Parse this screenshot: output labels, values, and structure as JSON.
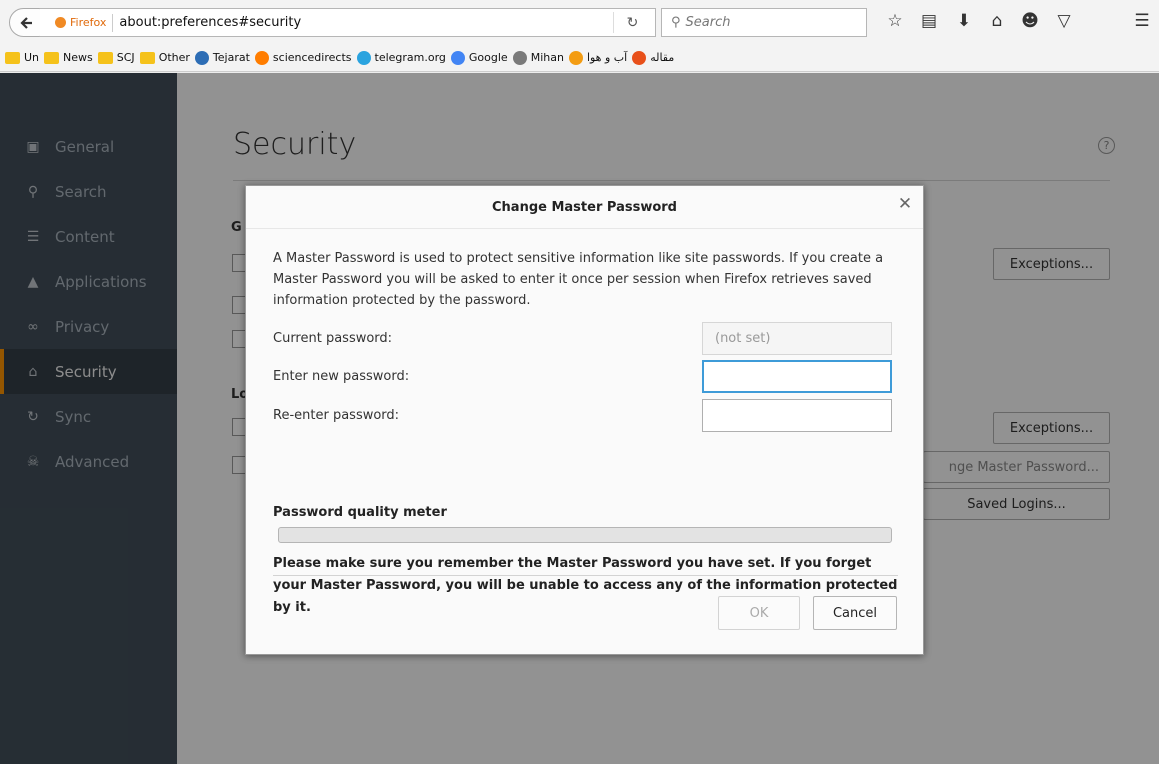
{
  "browser": {
    "identity_label": "Firefox",
    "url": "about:preferences#security",
    "reload_glyph": "↻",
    "search_placeholder": "Search",
    "toolbar_icons": [
      "star-icon",
      "reading-list-icon",
      "download-icon",
      "home-icon",
      "chat-icon",
      "pocket-icon",
      "hamburger-menu-icon"
    ]
  },
  "bookmarks": [
    {
      "label": "Un",
      "icon": "folder"
    },
    {
      "label": "News",
      "icon": "folder"
    },
    {
      "label": "SCJ",
      "icon": "folder"
    },
    {
      "label": "Other",
      "icon": "folder"
    },
    {
      "label": "Tejarat",
      "icon": "tejarat-icon",
      "color": "#2d6db5"
    },
    {
      "label": "sciencedirects",
      "icon": "elsevier-icon",
      "color": "#ff7d00"
    },
    {
      "label": "telegram.org",
      "icon": "telegram-icon",
      "color": "#2aa3df"
    },
    {
      "label": "Google",
      "icon": "google-icon",
      "color": "#4285f4"
    },
    {
      "label": "Mihan",
      "icon": "mihan-icon",
      "color": "#7a7a7a"
    },
    {
      "label": "آب و هوا",
      "icon": "weather-icon",
      "color": "#f39c12"
    },
    {
      "label": "مقاله",
      "icon": "eye-icon",
      "color": "#e8501a"
    }
  ],
  "sidebar": {
    "items": [
      {
        "label": "General",
        "icon": "general-icon",
        "glyph": "▣"
      },
      {
        "label": "Search",
        "icon": "search-icon",
        "glyph": "⚲"
      },
      {
        "label": "Content",
        "icon": "content-icon",
        "glyph": "☰"
      },
      {
        "label": "Applications",
        "icon": "applications-icon",
        "glyph": "▲"
      },
      {
        "label": "Privacy",
        "icon": "privacy-mask-icon",
        "glyph": "∞"
      },
      {
        "label": "Security",
        "icon": "security-lock-icon",
        "glyph": "⌂",
        "selected": true
      },
      {
        "label": "Sync",
        "icon": "sync-icon",
        "glyph": "↻"
      },
      {
        "label": "Advanced",
        "icon": "advanced-icon",
        "glyph": "☠"
      }
    ]
  },
  "page": {
    "title": "Security",
    "help_glyph": "?",
    "heading_fragment_1": "G",
    "heading_fragment_2": "Lo",
    "exceptions_label_1": "Exceptions...",
    "exceptions_label_2": "Exceptions...",
    "change_master_label": "nge Master Password...",
    "saved_logins_label": "Saved Logins..."
  },
  "dialog": {
    "title": "Change Master Password",
    "close_glyph": "✕",
    "description": "A Master Password is used to protect sensitive information like site passwords. If you create a Master Password you will be asked to enter it once per session when Firefox retrieves saved information protected by the password.",
    "current_label": "Current password:",
    "current_value": "(not set)",
    "new_label": "Enter new password:",
    "new_value": "",
    "reenter_label": "Re-enter password:",
    "reenter_value": "",
    "meter_label": "Password quality meter",
    "meter_value": 0,
    "warning": "Please make sure you remember the Master Password you have set. If you forget your Master Password, you will be unable to access any of the information protected by it.",
    "ok_label": "OK",
    "cancel_label": "Cancel"
  }
}
